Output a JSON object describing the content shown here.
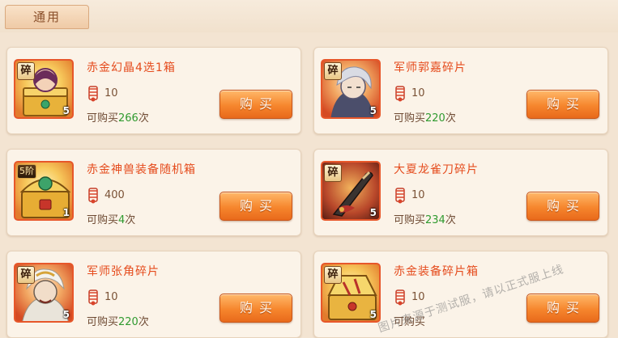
{
  "tabs": {
    "general_label": "通用"
  },
  "colors": {
    "name": "#e54b1c",
    "remaining_number": "#2f9a2f",
    "button": "#f6862d"
  },
  "cards": [
    {
      "name": "赤金幻晶4选1箱",
      "cost": "10",
      "remain_prefix": "可购买",
      "remain_count": "266",
      "remain_suffix": "次",
      "buy_label": "购买",
      "badge": "碎",
      "stack": "5",
      "icon": "gold-chest-portrait-icon"
    },
    {
      "name": "军师郭嘉碎片",
      "cost": "10",
      "remain_prefix": "可购买",
      "remain_count": "220",
      "remain_suffix": "次",
      "buy_label": "购买",
      "badge": "碎",
      "stack": "5",
      "icon": "guo-jia-portrait-icon"
    },
    {
      "name": "赤金神兽装备随机箱",
      "cost": "400",
      "remain_prefix": "可购买",
      "remain_count": "4",
      "remain_suffix": "次",
      "buy_label": "购买",
      "badge": "5阶",
      "stack": "1",
      "icon": "gold-chest-icon"
    },
    {
      "name": "大夏龙雀刀碎片",
      "cost": "10",
      "remain_prefix": "可购买",
      "remain_count": "234",
      "remain_suffix": "次",
      "buy_label": "购买",
      "badge": "碎",
      "stack": "5",
      "icon": "dragon-blade-icon"
    },
    {
      "name": "军师张角碎片",
      "cost": "10",
      "remain_prefix": "可购买",
      "remain_count": "220",
      "remain_suffix": "次",
      "buy_label": "购买",
      "badge": "碎",
      "stack": "5",
      "icon": "zhang-jiao-portrait-icon"
    },
    {
      "name": "赤金装备碎片箱",
      "cost": "10",
      "remain_prefix": "可购买",
      "remain_count": "",
      "remain_suffix": "",
      "buy_label": "购买",
      "badge": "碎",
      "stack": "5",
      "icon": "gold-equipment-chest-icon"
    }
  ],
  "watermark": "图片来源于测试服，请以正式服上线"
}
